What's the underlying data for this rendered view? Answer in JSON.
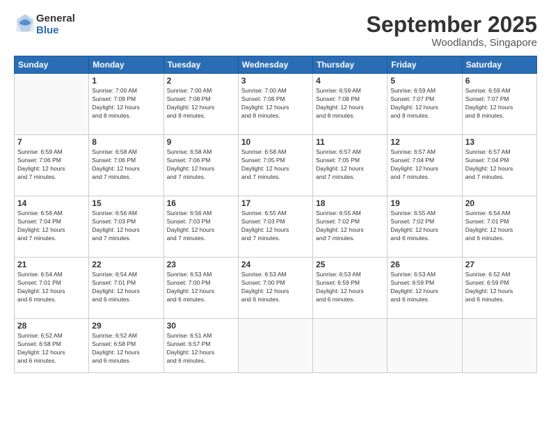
{
  "header": {
    "logo_line1": "General",
    "logo_line2": "Blue",
    "month": "September 2025",
    "location": "Woodlands, Singapore"
  },
  "weekdays": [
    "Sunday",
    "Monday",
    "Tuesday",
    "Wednesday",
    "Thursday",
    "Friday",
    "Saturday"
  ],
  "weeks": [
    [
      {
        "day": "",
        "info": ""
      },
      {
        "day": "1",
        "info": "Sunrise: 7:00 AM\nSunset: 7:09 PM\nDaylight: 12 hours\nand 8 minutes."
      },
      {
        "day": "2",
        "info": "Sunrise: 7:00 AM\nSunset: 7:08 PM\nDaylight: 12 hours\nand 8 minutes."
      },
      {
        "day": "3",
        "info": "Sunrise: 7:00 AM\nSunset: 7:08 PM\nDaylight: 12 hours\nand 8 minutes."
      },
      {
        "day": "4",
        "info": "Sunrise: 6:59 AM\nSunset: 7:08 PM\nDaylight: 12 hours\nand 8 minutes."
      },
      {
        "day": "5",
        "info": "Sunrise: 6:59 AM\nSunset: 7:07 PM\nDaylight: 12 hours\nand 8 minutes."
      },
      {
        "day": "6",
        "info": "Sunrise: 6:59 AM\nSunset: 7:07 PM\nDaylight: 12 hours\nand 8 minutes."
      }
    ],
    [
      {
        "day": "7",
        "info": "Sunrise: 6:59 AM\nSunset: 7:06 PM\nDaylight: 12 hours\nand 7 minutes."
      },
      {
        "day": "8",
        "info": "Sunrise: 6:58 AM\nSunset: 7:06 PM\nDaylight: 12 hours\nand 7 minutes."
      },
      {
        "day": "9",
        "info": "Sunrise: 6:58 AM\nSunset: 7:06 PM\nDaylight: 12 hours\nand 7 minutes."
      },
      {
        "day": "10",
        "info": "Sunrise: 6:58 AM\nSunset: 7:05 PM\nDaylight: 12 hours\nand 7 minutes."
      },
      {
        "day": "11",
        "info": "Sunrise: 6:57 AM\nSunset: 7:05 PM\nDaylight: 12 hours\nand 7 minutes."
      },
      {
        "day": "12",
        "info": "Sunrise: 6:57 AM\nSunset: 7:04 PM\nDaylight: 12 hours\nand 7 minutes."
      },
      {
        "day": "13",
        "info": "Sunrise: 6:57 AM\nSunset: 7:04 PM\nDaylight: 12 hours\nand 7 minutes."
      }
    ],
    [
      {
        "day": "14",
        "info": "Sunrise: 6:56 AM\nSunset: 7:04 PM\nDaylight: 12 hours\nand 7 minutes."
      },
      {
        "day": "15",
        "info": "Sunrise: 6:56 AM\nSunset: 7:03 PM\nDaylight: 12 hours\nand 7 minutes."
      },
      {
        "day": "16",
        "info": "Sunrise: 6:56 AM\nSunset: 7:03 PM\nDaylight: 12 hours\nand 7 minutes."
      },
      {
        "day": "17",
        "info": "Sunrise: 6:55 AM\nSunset: 7:03 PM\nDaylight: 12 hours\nand 7 minutes."
      },
      {
        "day": "18",
        "info": "Sunrise: 6:55 AM\nSunset: 7:02 PM\nDaylight: 12 hours\nand 7 minutes."
      },
      {
        "day": "19",
        "info": "Sunrise: 6:55 AM\nSunset: 7:02 PM\nDaylight: 12 hours\nand 6 minutes."
      },
      {
        "day": "20",
        "info": "Sunrise: 6:54 AM\nSunset: 7:01 PM\nDaylight: 12 hours\nand 6 minutes."
      }
    ],
    [
      {
        "day": "21",
        "info": "Sunrise: 6:54 AM\nSunset: 7:01 PM\nDaylight: 12 hours\nand 6 minutes."
      },
      {
        "day": "22",
        "info": "Sunrise: 6:54 AM\nSunset: 7:01 PM\nDaylight: 12 hours\nand 6 minutes."
      },
      {
        "day": "23",
        "info": "Sunrise: 6:53 AM\nSunset: 7:00 PM\nDaylight: 12 hours\nand 6 minutes."
      },
      {
        "day": "24",
        "info": "Sunrise: 6:53 AM\nSunset: 7:00 PM\nDaylight: 12 hours\nand 6 minutes."
      },
      {
        "day": "25",
        "info": "Sunrise: 6:53 AM\nSunset: 6:59 PM\nDaylight: 12 hours\nand 6 minutes."
      },
      {
        "day": "26",
        "info": "Sunrise: 6:53 AM\nSunset: 6:59 PM\nDaylight: 12 hours\nand 6 minutes."
      },
      {
        "day": "27",
        "info": "Sunrise: 6:52 AM\nSunset: 6:59 PM\nDaylight: 12 hours\nand 6 minutes."
      }
    ],
    [
      {
        "day": "28",
        "info": "Sunrise: 6:52 AM\nSunset: 6:58 PM\nDaylight: 12 hours\nand 6 minutes."
      },
      {
        "day": "29",
        "info": "Sunrise: 6:52 AM\nSunset: 6:58 PM\nDaylight: 12 hours\nand 6 minutes."
      },
      {
        "day": "30",
        "info": "Sunrise: 6:51 AM\nSunset: 6:57 PM\nDaylight: 12 hours\nand 6 minutes."
      },
      {
        "day": "",
        "info": ""
      },
      {
        "day": "",
        "info": ""
      },
      {
        "day": "",
        "info": ""
      },
      {
        "day": "",
        "info": ""
      }
    ]
  ]
}
